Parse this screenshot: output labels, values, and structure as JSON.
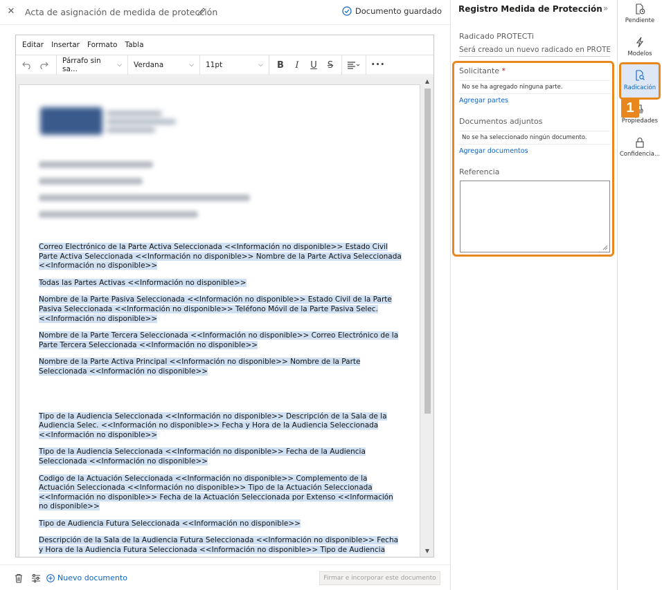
{
  "header": {
    "close_icon": "close-icon",
    "title": "Acta de asignación de medida de protección",
    "edit_icon": "pencil-icon",
    "status": "Documento guardado",
    "status_icon": "check-circle-icon"
  },
  "editor": {
    "menu": [
      "Editar",
      "Insertar",
      "Formato",
      "Tabla"
    ],
    "toolbar": {
      "undo_icon": "undo-icon",
      "redo_icon": "redo-icon",
      "block_format": "Párrafo sin sa...",
      "font_family": "Verdana",
      "font_size": "11pt",
      "bold": "B",
      "italic": "I",
      "underline": "U",
      "strike": "S",
      "align_icon": "align-left-icon",
      "more": "•••"
    },
    "paragraphs": [
      "Correo Electrónico de la Parte Activa Seleccionada <<Información no disponible>> Estado Civil Parte Activa Seleccionada <<Información no disponible>> Nombre de la Parte Activa Seleccionada <<Información no disponible>>",
      "Todas las Partes Activas <<Información no disponible>>",
      "Nombre de la Parte Pasiva Seleccionada <<Información no disponible>> Estado Civil de la Parte Pasiva Seleccionada <<Información no disponible>> Teléfono Móvil de la Parte Pasiva Selec. <<Información no disponible>>",
      "Nombre de la Parte Tercera Seleccionada <<Información no disponible>> Correo Electrónico de la Parte Tercera Seleccionada <<Información no disponible>>",
      "Nombre de la Parte Activa Principal <<Información no disponible>> Nombre de la Parte Seleccionada <<Información no disponible>>",
      "Tipo de la Audiencia Seleccionada <<Información no disponible>> Descripción de la Sala de la Audiencia Selec. <<Información no disponible>>  Fecha y Hora de la Audiencia Seleccionada <<Información no disponible>>",
      "Tipo de la Audiencia Seleccionada <<Información no disponible>> Fecha de la Audiencia Seleccionada <<Información no disponible>>",
      "Codigo de la Actuación Seleccionada <<Información no disponible>> Complemento de la Actuación Seleccionada <<Información no disponible>> Tipo de la Actuación Seleccionada <<Información no disponible>> Fecha de la Actuación Seleccionada por Extenso <<Información no disponible>>",
      "Tipo de Audiencia Futura Seleccionada <<Información no disponible>>",
      "Descripción de la Sala de la Audiencia Futura Seleccionada <<Información no disponible>> Fecha y Hora de la Audiencia Futura Seleccionada <<Información no disponible>> Tipo de Audiencia"
    ]
  },
  "footer": {
    "delete_icon": "trash-icon",
    "settings_icon": "sliders-icon",
    "new_doc": "Nuevo documento",
    "sign_button": "Firmar e incorporar este documento"
  },
  "panel": {
    "title": "Registro Medida de Protección",
    "collapse": "»",
    "radicado_label": "Radicado PROTECTi",
    "radicado_value": "Será creado un nuevo radicado en PROTECTi",
    "solicitante_label": "Solicitante",
    "solicitante_required": "*",
    "solicitante_empty": "No se ha agregado ninguna parte.",
    "add_parties": "Agregar partes",
    "docs_label": "Documentos adjuntos",
    "docs_empty": "No se ha seleccionado ningún documento.",
    "add_docs": "Agregar documentos",
    "ref_label": "Referencia",
    "ref_value": ""
  },
  "rail": {
    "items": [
      {
        "label": "Pendiente",
        "icon": "pending-doc-icon"
      },
      {
        "label": "Modelos",
        "icon": "lightning-icon"
      },
      {
        "label": "Radicación",
        "icon": "doc-search-icon"
      },
      {
        "label": "Propiedades",
        "icon": "stamp-icon"
      },
      {
        "label": "Confidencia...",
        "icon": "lock-icon"
      }
    ],
    "active": "Radicación",
    "step_badge": "1"
  },
  "colors": {
    "highlight": "#e8871e",
    "link": "#0b63c4",
    "selection": "#cfe0f3",
    "active_tab": "#dde7f6"
  }
}
